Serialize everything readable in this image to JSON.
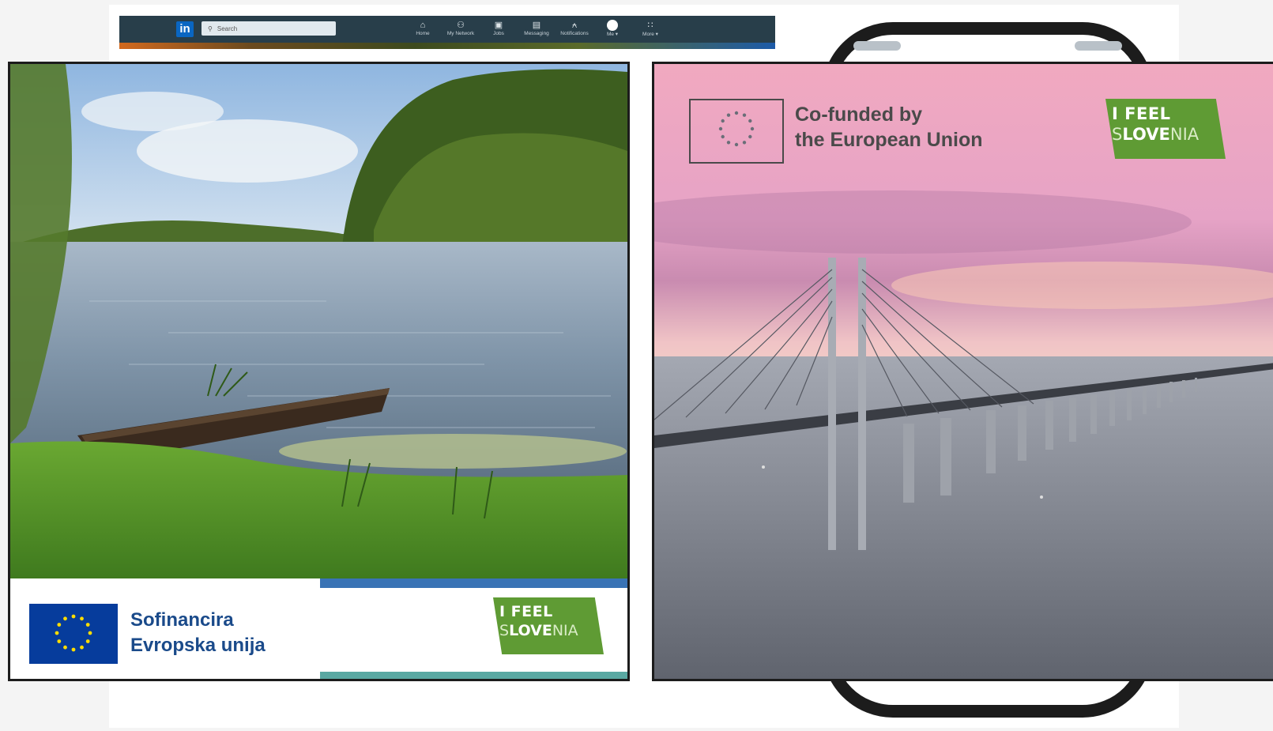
{
  "linkedin": {
    "logo": "in",
    "search_placeholder": "Search",
    "nav": [
      {
        "label": "Home",
        "icon": "home-icon"
      },
      {
        "label": "My Network",
        "icon": "network-icon"
      },
      {
        "label": "Jobs",
        "icon": "briefcase-icon"
      },
      {
        "label": "Messaging",
        "icon": "chat-icon"
      },
      {
        "label": "Notifications",
        "icon": "bell-icon"
      },
      {
        "label": "Me ▾",
        "icon": "avatar-icon"
      },
      {
        "label": "More ▾",
        "icon": "grid-icon"
      }
    ]
  },
  "left_card": {
    "eu_line1": "Sofinancira",
    "eu_line2": "Evropska unija",
    "brand_line1": "I FEEL",
    "brand_s": "S",
    "brand_love": "LOVE",
    "brand_nia": "NIA"
  },
  "right_card": {
    "eu_line1": "Co-funded by",
    "eu_line2": "the European Union",
    "brand_line1": "I FEEL",
    "brand_s": "S",
    "brand_love": "LOVE",
    "brand_nia": "NIA"
  },
  "colors": {
    "eu_blue": "#063c9c",
    "eu_star": "#ffdd00",
    "brand_green": "#5f9b34",
    "linkedin_bar": "#283e4a",
    "linkedin_blue": "#0a66c2"
  }
}
